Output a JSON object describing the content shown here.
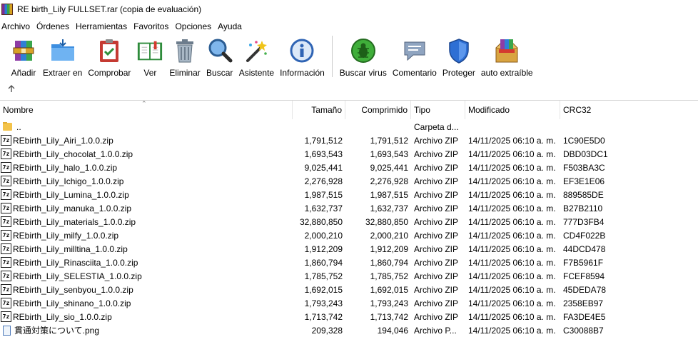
{
  "window": {
    "title": "RE birth_Lily FULLSET.rar (copia de evaluación)"
  },
  "menu": [
    "Archivo",
    "Órdenes",
    "Herramientas",
    "Favoritos",
    "Opciones",
    "Ayuda"
  ],
  "toolbar": {
    "add": "Añadir",
    "extract": "Extraer en",
    "test": "Comprobar",
    "view": "Ver",
    "delete": "Eliminar",
    "find": "Buscar",
    "wizard": "Asistente",
    "info": "Información",
    "virus": "Buscar virus",
    "comment": "Comentario",
    "protect": "Proteger",
    "sfx": "auto extraíble"
  },
  "columns": {
    "name": "Nombre",
    "size": "Tamaño",
    "packed": "Comprimido",
    "type": "Tipo",
    "modified": "Modificado",
    "crc": "CRC32"
  },
  "parent_row": {
    "name": "..",
    "type": "Carpeta d..."
  },
  "files": [
    {
      "name": "REbirth_Lily_Airi_1.0.0.zip",
      "size": "1,791,512",
      "packed": "1,791,512",
      "type": "Archivo ZIP",
      "modified": "14/11/2025 06:10 a. m.",
      "crc": "1C90E5D0"
    },
    {
      "name": "REbirth_Lily_chocolat_1.0.0.zip",
      "size": "1,693,543",
      "packed": "1,693,543",
      "type": "Archivo ZIP",
      "modified": "14/11/2025 06:10 a. m.",
      "crc": "DBD03DC1"
    },
    {
      "name": "REbirth_Lily_halo_1.0.0.zip",
      "size": "9,025,441",
      "packed": "9,025,441",
      "type": "Archivo ZIP",
      "modified": "14/11/2025 06:10 a. m.",
      "crc": "F503BA3C"
    },
    {
      "name": "REbirth_Lily_Ichigo_1.0.0.zip",
      "size": "2,276,928",
      "packed": "2,276,928",
      "type": "Archivo ZIP",
      "modified": "14/11/2025 06:10 a. m.",
      "crc": "EF3E1E06"
    },
    {
      "name": "REbirth_Lily_Lumina_1.0.0.zip",
      "size": "1,987,515",
      "packed": "1,987,515",
      "type": "Archivo ZIP",
      "modified": "14/11/2025 06:10 a. m.",
      "crc": "889585DE"
    },
    {
      "name": "REbirth_Lily_manuka_1.0.0.zip",
      "size": "1,632,737",
      "packed": "1,632,737",
      "type": "Archivo ZIP",
      "modified": "14/11/2025 06:10 a. m.",
      "crc": "B27B2110"
    },
    {
      "name": "REbirth_Lily_materials_1.0.0.zip",
      "size": "32,880,850",
      "packed": "32,880,850",
      "type": "Archivo ZIP",
      "modified": "14/11/2025 06:10 a. m.",
      "crc": "777D3FB4"
    },
    {
      "name": "REbirth_Lily_milfy_1.0.0.zip",
      "size": "2,000,210",
      "packed": "2,000,210",
      "type": "Archivo ZIP",
      "modified": "14/11/2025 06:10 a. m.",
      "crc": "CD4F022B"
    },
    {
      "name": "REbirth_Lily_milltina_1.0.0.zip",
      "size": "1,912,209",
      "packed": "1,912,209",
      "type": "Archivo ZIP",
      "modified": "14/11/2025 06:10 a. m.",
      "crc": "44DCD478"
    },
    {
      "name": "REbirth_Lily_Rinasciita_1.0.0.zip",
      "size": "1,860,794",
      "packed": "1,860,794",
      "type": "Archivo ZIP",
      "modified": "14/11/2025 06:10 a. m.",
      "crc": "F7B5961F"
    },
    {
      "name": "REbirth_Lily_SELESTIA_1.0.0.zip",
      "size": "1,785,752",
      "packed": "1,785,752",
      "type": "Archivo ZIP",
      "modified": "14/11/2025 06:10 a. m.",
      "crc": "FCEF8594"
    },
    {
      "name": "REbirth_Lily_senbyou_1.0.0.zip",
      "size": "1,692,015",
      "packed": "1,692,015",
      "type": "Archivo ZIP",
      "modified": "14/11/2025 06:10 a. m.",
      "crc": "45DEDA78"
    },
    {
      "name": "REbirth_Lily_shinano_1.0.0.zip",
      "size": "1,793,243",
      "packed": "1,793,243",
      "type": "Archivo ZIP",
      "modified": "14/11/2025 06:10 a. m.",
      "crc": "2358EB97"
    },
    {
      "name": "REbirth_Lily_sio_1.0.0.zip",
      "size": "1,713,742",
      "packed": "1,713,742",
      "type": "Archivo ZIP",
      "modified": "14/11/2025 06:10 a. m.",
      "crc": "FA3DE4E5"
    },
    {
      "name": "貫通対策について.png",
      "size": "209,328",
      "packed": "194,046",
      "type": "Archivo P...",
      "modified": "14/11/2025 06:10 a. m.",
      "crc": "C30088B7"
    }
  ]
}
